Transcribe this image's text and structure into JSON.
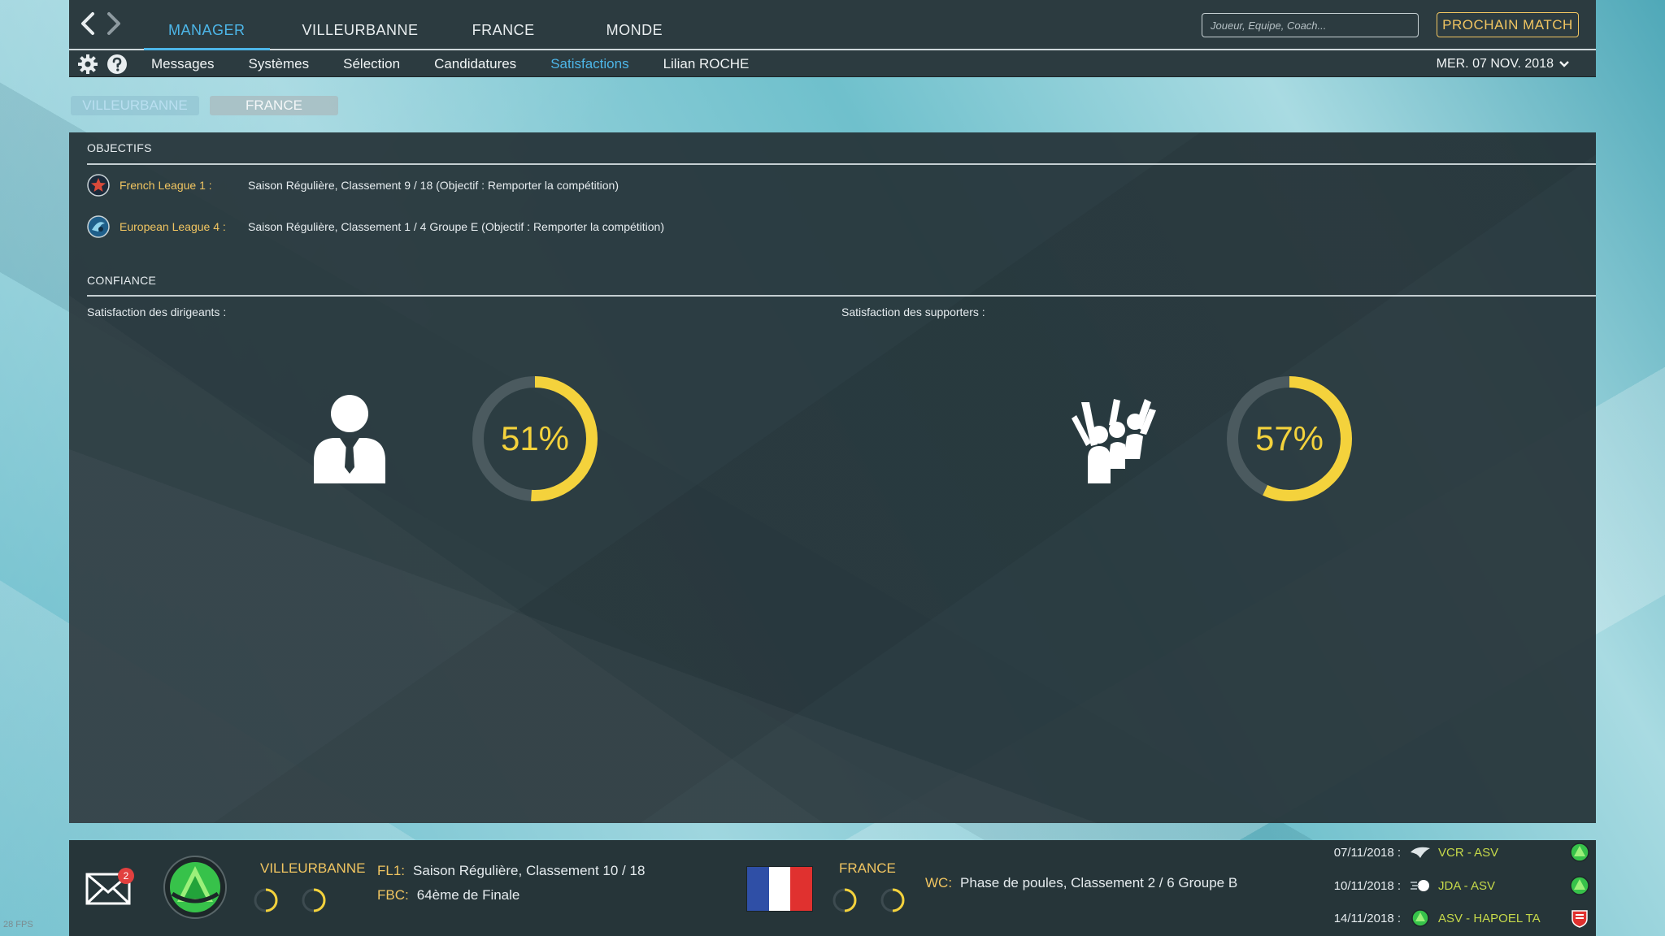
{
  "nav": {
    "tabs": [
      "MANAGER",
      "VILLEURBANNE",
      "FRANCE",
      "MONDE"
    ],
    "search_placeholder": "Joueur, Equipe, Coach...",
    "next_match": "PROCHAIN MATCH"
  },
  "subnav": {
    "tabs": [
      "Messages",
      "Systèmes",
      "Sélection",
      "Candidatures",
      "Satisfactions",
      "Lilian ROCHE"
    ],
    "date": "MER. 07 NOV. 2018"
  },
  "context_tabs": [
    "VILLEURBANNE",
    "FRANCE"
  ],
  "objectives": {
    "heading": "OBJECTIFS",
    "rows": [
      {
        "competition": "French League 1 :",
        "description": "Saison Régulière, Classement 9 / 18 (Objectif : Remporter la compétition)"
      },
      {
        "competition": "European League 4 :",
        "description": "Saison Régulière, Classement 1 / 4 Groupe E  (Objectif : Remporter la compétition)"
      }
    ]
  },
  "confidence": {
    "heading": "CONFIANCE",
    "board": {
      "label": "Satisfaction des dirigeants :",
      "value": 51,
      "display": "51%"
    },
    "fans": {
      "label": "Satisfaction des supporters :",
      "value": 57,
      "display": "57%"
    }
  },
  "bottom": {
    "mail_count": "2",
    "club": {
      "name": "VILLEURBANNE",
      "lines": [
        {
          "key": "FL1:",
          "text": "Saison Régulière, Classement 10 / 18"
        },
        {
          "key": "FBC:",
          "text": "64ème de Finale"
        }
      ]
    },
    "nation": {
      "name": "FRANCE",
      "line": {
        "key": "WC:",
        "text": "Phase de poules, Classement 2 / 6 Groupe B"
      }
    },
    "fixtures": [
      {
        "date": "07/11/2018 :",
        "match": "VCR - ASV"
      },
      {
        "date": "10/11/2018 :",
        "match": "JDA - ASV"
      },
      {
        "date": "14/11/2018 :",
        "match": "ASV - HAPOEL TA"
      }
    ]
  },
  "fps": "28 FPS",
  "colors": {
    "accent": "#4db6e8",
    "gold": "#f1c561",
    "gauge": "#f4d23c",
    "match": "#c6d94a"
  }
}
